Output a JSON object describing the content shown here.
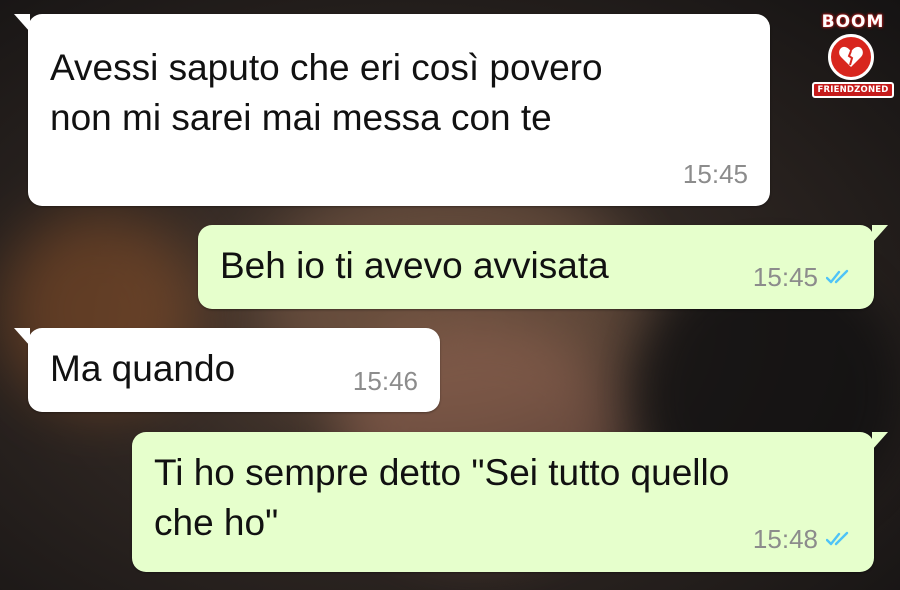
{
  "logo": {
    "top_text": "BOOM",
    "banner_text": "FRIENDZONED"
  },
  "messages": [
    {
      "direction": "incoming",
      "lines": [
        "Avessi saputo che eri così povero",
        "non mi sarei mai messa con te"
      ],
      "time": "15:45"
    },
    {
      "direction": "outgoing",
      "lines": [
        "Beh io ti avevo avvisata"
      ],
      "time": "15:45",
      "status": "read-double-check-icon"
    },
    {
      "direction": "incoming",
      "lines": [
        "Ma quando"
      ],
      "time": "15:46"
    },
    {
      "direction": "outgoing",
      "lines": [
        "Ti ho sempre detto \"Sei tutto quello",
        "che ho\""
      ],
      "time": "15:48",
      "status": "read-double-check-icon"
    }
  ],
  "colors": {
    "incoming_bubble": "#ffffff",
    "outgoing_bubble": "#e6ffcc",
    "timestamp": "#8c8c8c",
    "read_ticks": "#4fc3f7",
    "logo_red": "#d8261e"
  }
}
